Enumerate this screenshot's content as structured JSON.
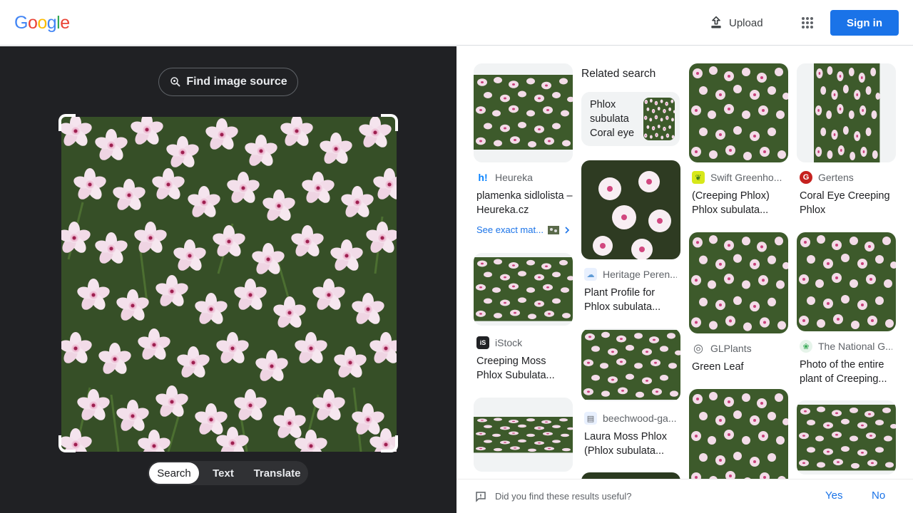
{
  "header": {
    "logo": [
      "G",
      "o",
      "o",
      "g",
      "l",
      "e"
    ],
    "logo_colors": [
      "#4285F4",
      "#EA4335",
      "#FBBC05",
      "#4285F4",
      "#34A853",
      "#EA4335"
    ],
    "upload_label": "Upload",
    "signin_label": "Sign in"
  },
  "left": {
    "find_source_label": "Find image source",
    "modes": [
      "Search",
      "Text",
      "Translate"
    ],
    "active_mode": "Search"
  },
  "right": {
    "related_heading": "Related search",
    "related_query": "Phlox subulata Coral eye",
    "see_exact": "See exact mat...",
    "results": [
      {
        "source": "Heureka",
        "title": "plamenka sidlolista – Heureka.cz",
        "favicon": "h!",
        "fav_color": "#0a84ff"
      },
      {
        "source": "Swift Greenho...",
        "title": "(Creeping Phlox) Phlox subulata...",
        "favicon": "❦",
        "fav_color": "#d7e81a"
      },
      {
        "source": "Gertens",
        "title": "Coral Eye Creeping Phlox",
        "favicon": "G",
        "fav_color": "#c5221f"
      },
      {
        "source": "Heritage Peren...",
        "title": "Plant Profile for Phlox subulata...",
        "favicon": "☁",
        "fav_color": "#8ab4f8"
      },
      {
        "source": "iStock",
        "title": "Creeping Moss Phlox Subulata...",
        "favicon": "iS",
        "fav_color": "#202124"
      },
      {
        "source": "GLPlants",
        "title": "Green Leaf",
        "favicon": "◎",
        "fav_color": "#ffffff"
      },
      {
        "source": "The National G...",
        "title": "Photo of the entire plant of Creeping...",
        "favicon": "❀",
        "fav_color": "#e6f4ea"
      },
      {
        "source": "beechwood-ga...",
        "title": "Laura Moss Phlox (Phlox subulata...",
        "favicon": "▤",
        "fav_color": "#e8f0fe"
      }
    ]
  },
  "feedback": {
    "question": "Did you find these results useful?",
    "yes": "Yes",
    "no": "No"
  }
}
